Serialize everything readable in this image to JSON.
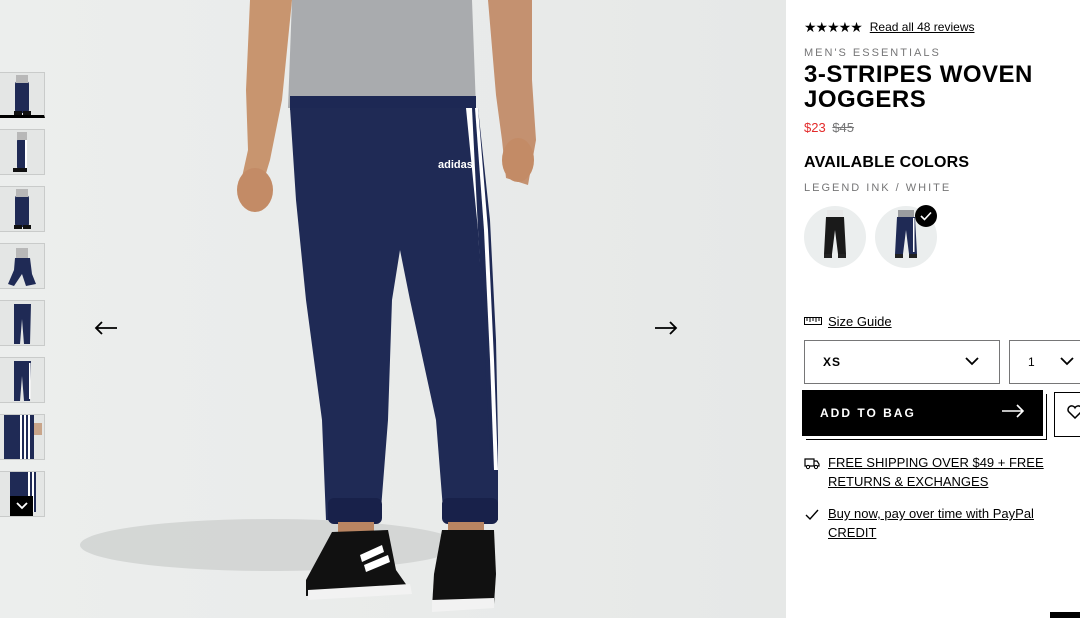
{
  "gallery": {
    "thumbnails": [
      {
        "icon": "product-view-front"
      },
      {
        "icon": "product-view-side"
      },
      {
        "icon": "product-view-back"
      },
      {
        "icon": "product-view-kneel"
      },
      {
        "icon": "product-view-flat-front"
      },
      {
        "icon": "product-view-flat-back"
      },
      {
        "icon": "product-view-detail-side"
      },
      {
        "icon": "product-view-detail-leg"
      }
    ],
    "prev_icon": "arrow-left-icon",
    "next_icon": "arrow-right-icon",
    "scroll_down_icon": "chevron-down-icon"
  },
  "product": {
    "rating_stars": "★★★★★",
    "rating_value": 4.5,
    "reviews_link": "Read all 48 reviews",
    "category": "MEN'S ESSENTIALS",
    "title": "3-Stripes Woven Joggers",
    "sale_price": "$23",
    "original_price": "$45",
    "colors_heading": "AVAILABLE COLORS",
    "selected_color_name": "LEGEND INK / WHITE",
    "swatches": [
      {
        "name": "black joggers",
        "selected": false
      },
      {
        "name": "legend ink joggers",
        "selected": true
      }
    ],
    "size_guide_label": "Size Guide",
    "size_value": "XS",
    "quantity_value": "1",
    "add_to_bag_label": "ADD TO BAG",
    "shipping_text": "FREE SHIPPING OVER $49 + FREE RETURNS & EXCHANGES",
    "paypal_text": "Buy now, pay over time with PayPal CREDIT"
  },
  "colors": {
    "sale_price": "#e32b2b",
    "navy": "#1f2a55",
    "accent": "#000000",
    "muted_text": "#767677"
  }
}
